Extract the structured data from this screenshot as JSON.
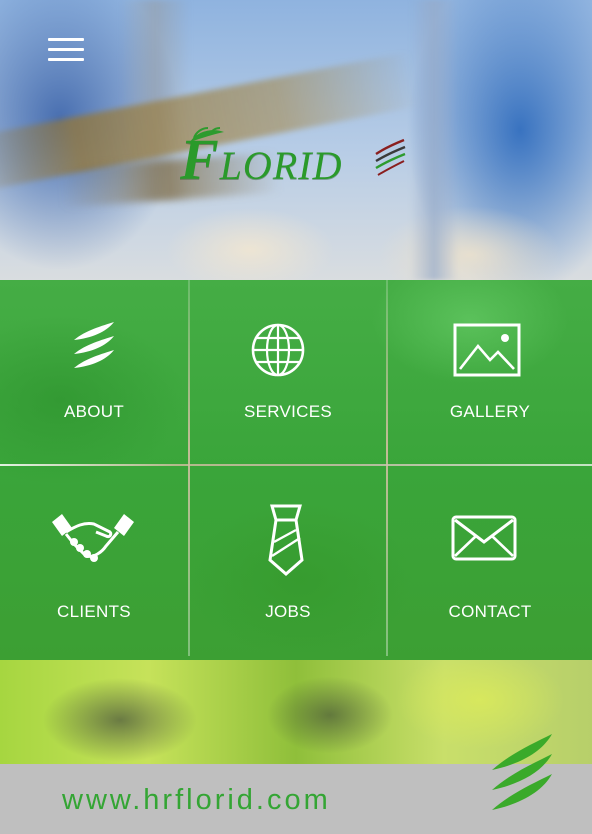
{
  "header": {
    "logo_text_first": "F",
    "logo_text_rest": "LORID"
  },
  "menu": [
    {
      "label": "ABOUT",
      "icon": "waves-icon"
    },
    {
      "label": "SERVICES",
      "icon": "globe-icon"
    },
    {
      "label": "GALLERY",
      "icon": "image-icon"
    },
    {
      "label": "CLIENTS",
      "icon": "handshake-icon"
    },
    {
      "label": "JOBS",
      "icon": "tie-icon"
    },
    {
      "label": "CONTACT",
      "icon": "envelope-icon"
    }
  ],
  "footer": {
    "website": "www.hrflorid.com"
  },
  "colors": {
    "brand_green": "#2a9a2a",
    "tile_green": "#3ea53e",
    "footer_gray": "#bfbfbf"
  }
}
